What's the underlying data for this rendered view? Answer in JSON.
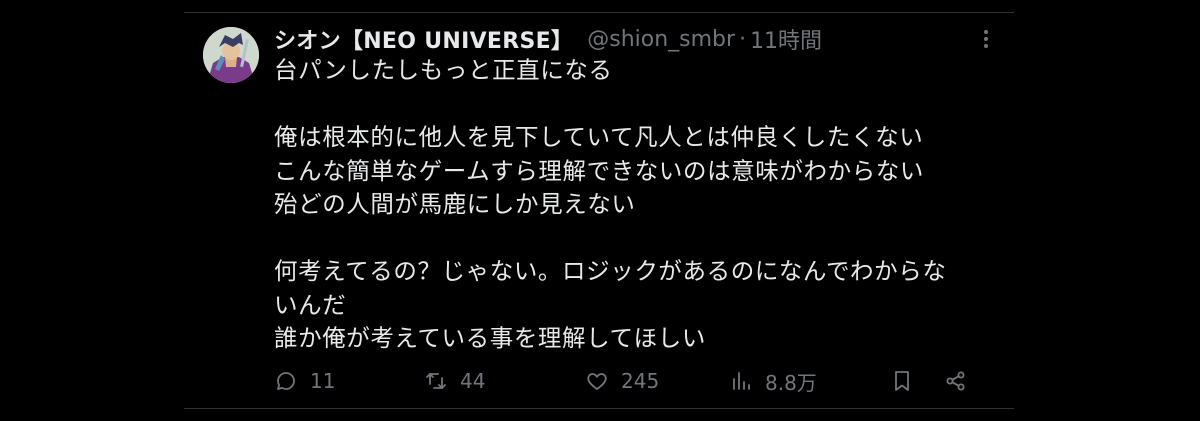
{
  "tweet": {
    "author": {
      "display_name": "シオン【NEO UNIVERSE】",
      "handle": "@shion_smbr",
      "separator": "·",
      "time": "11時間"
    },
    "text_lines": [
      "台パンしたしもっと正直になる",
      "",
      "俺は根本的に他人を見下していて凡人とは仲良くしたくない",
      "こんな簡単なゲームすら理解できないのは意味がわからない",
      "殆どの人間が馬鹿にしか見えない",
      "",
      "何考えてるの？じゃない。ロジックがあるのになんでわからな",
      "いんだ",
      "誰か俺が考えている事を理解してほしい"
    ],
    "actions": {
      "reply_count": "11",
      "retweet_count": "44",
      "like_count": "245",
      "view_count": "8.8万"
    },
    "icons": {
      "reply": "reply-icon",
      "retweet": "retweet-icon",
      "like": "heart-icon",
      "views": "views-icon",
      "bookmark": "bookmark-icon",
      "share": "share-icon",
      "more": "more-icon"
    },
    "colors": {
      "background": "#000000",
      "primary_text": "#e7e9ea",
      "secondary_text": "#71767b",
      "border": "#2f3336"
    }
  }
}
